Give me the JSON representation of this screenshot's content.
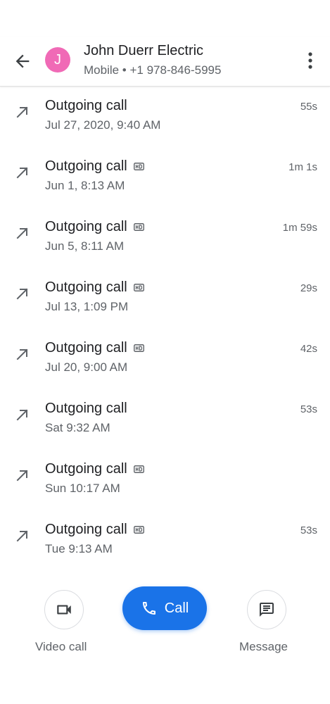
{
  "colors": {
    "avatar": "#f06ab6",
    "accent": "#1a73e8",
    "icon": "#5f6368"
  },
  "header": {
    "back_icon": "back-arrow-icon",
    "avatar_initial": "J",
    "contact_name": "John Duerr Electric",
    "contact_detail": "Mobile • +1 978-846-5995",
    "more_icon": "more-vert-icon"
  },
  "calls": [
    {
      "type": "Outgoing call",
      "hd": false,
      "time": "Jul 27, 2020, 9:40 AM",
      "duration": "55s"
    },
    {
      "type": "Outgoing call",
      "hd": true,
      "time": "Jun 1, 8:13 AM",
      "duration": "1m 1s"
    },
    {
      "type": "Outgoing call",
      "hd": true,
      "time": "Jun 5, 8:11 AM",
      "duration": "1m 59s"
    },
    {
      "type": "Outgoing call",
      "hd": true,
      "time": "Jul 13, 1:09 PM",
      "duration": "29s"
    },
    {
      "type": "Outgoing call",
      "hd": true,
      "time": "Jul 20, 9:00 AM",
      "duration": "42s"
    },
    {
      "type": "Outgoing call",
      "hd": false,
      "time": "Sat 9:32 AM",
      "duration": "53s"
    },
    {
      "type": "Outgoing call",
      "hd": true,
      "time": "Sun 10:17 AM",
      "duration": ""
    },
    {
      "type": "Outgoing call",
      "hd": true,
      "time": "Tue 9:13 AM",
      "duration": "53s"
    }
  ],
  "actions": {
    "video_call_label": "Video call",
    "call_label": "Call",
    "message_label": "Message",
    "video_icon": "video-camera-icon",
    "phone_icon": "phone-icon",
    "message_icon": "message-icon"
  }
}
